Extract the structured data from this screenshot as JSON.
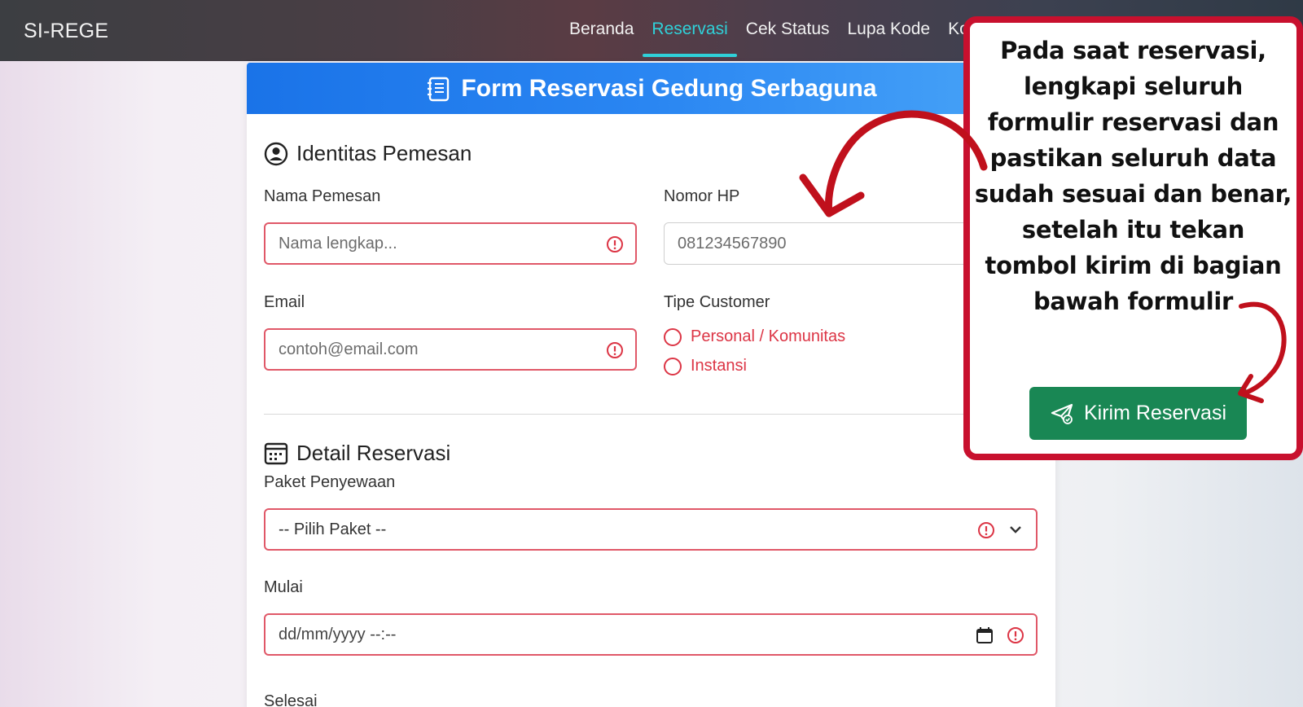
{
  "navbar": {
    "brand": "SI-REGE",
    "links": [
      {
        "label": "Beranda",
        "active": false
      },
      {
        "label": "Reservasi",
        "active": true
      },
      {
        "label": "Cek Status",
        "active": false
      },
      {
        "label": "Lupa Kode",
        "active": false
      },
      {
        "label": "Ko",
        "active": false
      }
    ]
  },
  "form": {
    "title": "Form Reservasi Gedung Serbaguna",
    "identity": {
      "title": "Identitas Pemesan",
      "name_label": "Nama Pemesan",
      "name_placeholder": "Nama lengkap...",
      "phone_label": "Nomor HP",
      "phone_placeholder": "081234567890",
      "email_label": "Email",
      "email_placeholder": "contoh@email.com",
      "customer_type_label": "Tipe Customer",
      "customer_type_options": [
        "Personal / Komunitas",
        "Instansi"
      ]
    },
    "detail": {
      "title": "Detail Reservasi",
      "package_label": "Paket Penyewaan",
      "package_selected": "-- Pilih Paket --",
      "start_label": "Mulai",
      "start_placeholder": "dd/mm/yyyy --:--",
      "end_label": "Selesai"
    }
  },
  "callout": {
    "text_lines": [
      "Pada saat reservasi,",
      "lengkapi seluruh",
      "formulir reservasi dan",
      "pastikan seluruh data",
      "sudah sesuai dan benar,",
      "setelah itu tekan",
      "tombol kirim di bagian",
      "bawah formulir"
    ],
    "submit_label": "Kirim Reservasi"
  },
  "colors": {
    "header_blue": "#1a73e8",
    "error_red": "#dc3545",
    "submit_green": "#198754",
    "callout_red": "#c8102e",
    "nav_active": "#2fd1d9"
  }
}
